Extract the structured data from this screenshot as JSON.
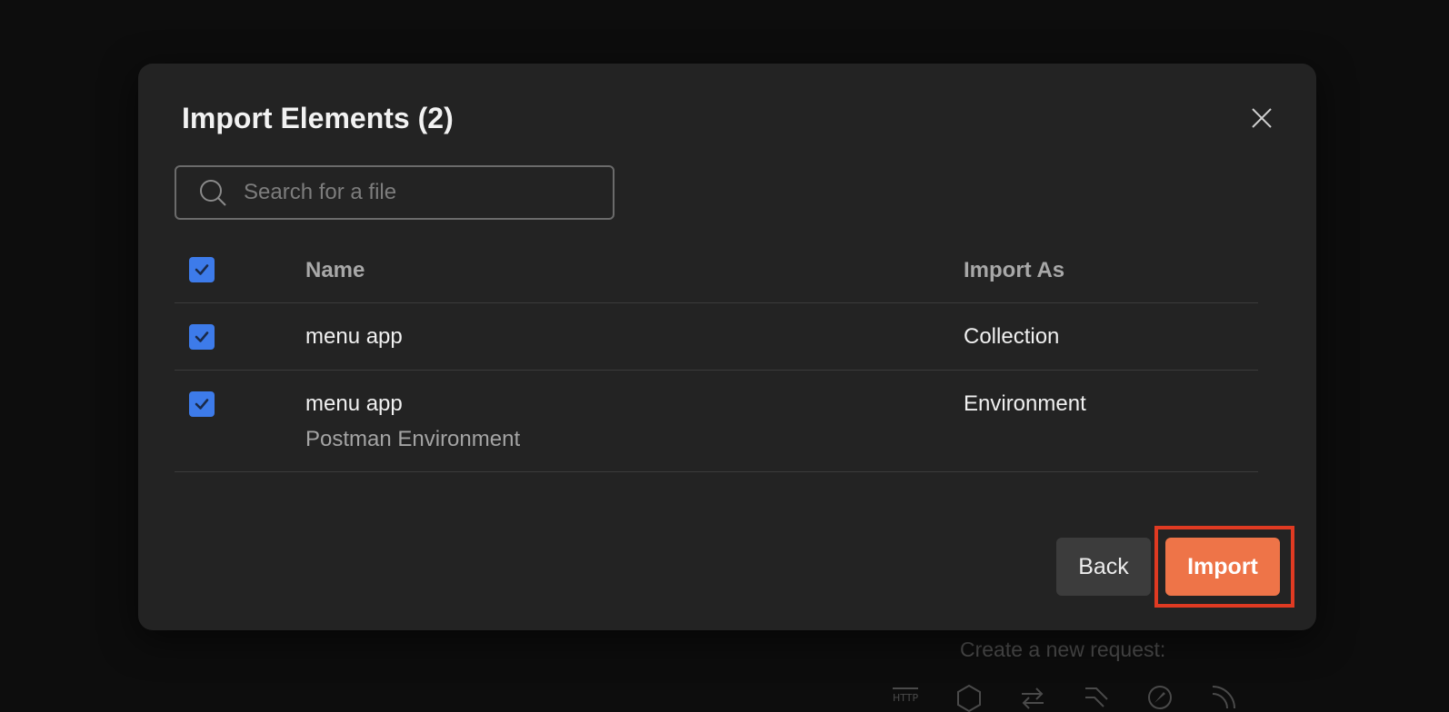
{
  "background": {
    "hint_text": "Create a new request:",
    "icons": [
      "http-icon",
      "graphql-icon",
      "websocket-icon",
      "socketio-icon",
      "grpc-icon",
      "mqtt-icon"
    ]
  },
  "dialog": {
    "title": "Import Elements (2)",
    "close_icon": "close-icon",
    "search": {
      "placeholder": "Search for a file",
      "value": ""
    },
    "table": {
      "columns": {
        "select_all_checked": true,
        "name": "Name",
        "import_as": "Import As"
      },
      "rows": [
        {
          "checked": true,
          "name": "menu app",
          "subtitle": "",
          "import_as": "Collection"
        },
        {
          "checked": true,
          "name": "menu app",
          "subtitle": "Postman Environment",
          "import_as": "Environment"
        }
      ]
    },
    "buttons": {
      "back": "Back",
      "import": "Import"
    },
    "colors": {
      "accent": "#ee7448",
      "checkbox": "#3d7bea",
      "highlight": "#e03a22"
    }
  }
}
